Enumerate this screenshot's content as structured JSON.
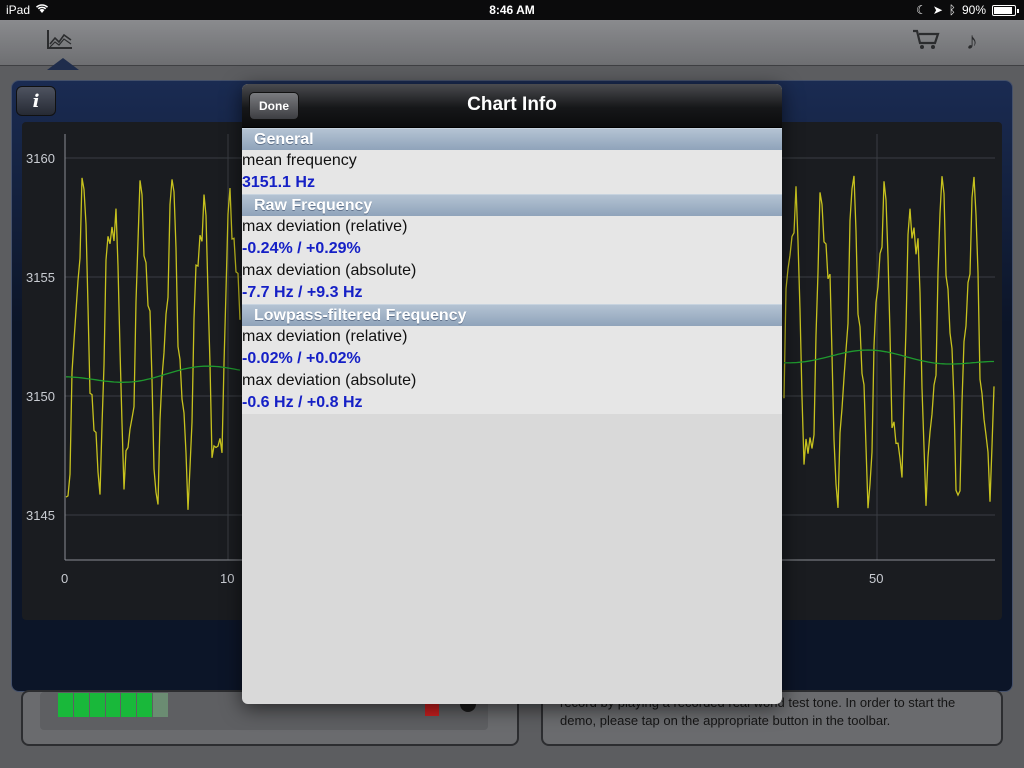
{
  "status_bar": {
    "device": "iPad",
    "time": "8:46 AM",
    "battery": "90%"
  },
  "chart_bg": {
    "y_ticks": [
      "3160",
      "3155",
      "3150",
      "3145"
    ],
    "x_ticks": [
      "0",
      "10",
      "50"
    ]
  },
  "bottom": {
    "help_text": "record by playing a recorded real world test tone. In order to start the demo, please tap on the appropriate button in the toolbar."
  },
  "modal": {
    "done_label": "Done",
    "title": "Chart Info",
    "sections": [
      {
        "heading": "General",
        "rows": [
          {
            "label": "mean frequency",
            "value": "3151.1 Hz"
          }
        ]
      },
      {
        "heading": "Raw Frequency",
        "rows": [
          {
            "label": "max deviation (relative)",
            "value": "-0.24% / +0.29%"
          },
          {
            "label": "max deviation (absolute)",
            "value": "-7.7 Hz / +9.3 Hz"
          }
        ]
      },
      {
        "heading": "Lowpass-filtered Frequency",
        "rows": [
          {
            "label": "max deviation (relative)",
            "value": "-0.02% / +0.02%"
          },
          {
            "label": "max deviation (absolute)",
            "value": "-0.6 Hz / +0.8 Hz"
          }
        ]
      }
    ]
  },
  "colors": {
    "raw_series": "#c7c21e",
    "filtered_series": "#1f9a2e",
    "value_text": "#1520c6"
  }
}
